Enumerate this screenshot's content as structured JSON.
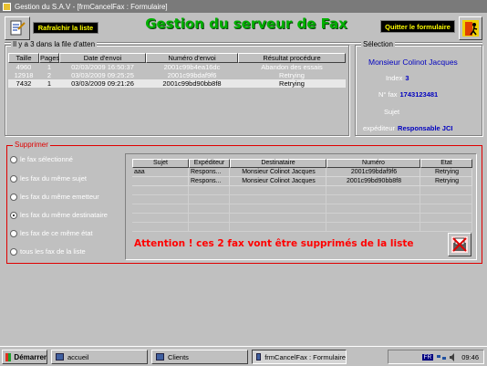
{
  "window": {
    "title": "Gestion du S.A.V - [frmCancelFax : Formulaire]"
  },
  "toolbar": {
    "refresh_label": "Rafraîchir la liste",
    "main_title": "Gestion du serveur de Fax",
    "quit_label": "Quitter le formulaire"
  },
  "fax_list": {
    "group_label": "Il y a 3 dans la file d'atten",
    "columns": [
      "Taille",
      "Pages",
      "Date d'envoi",
      "Numéro d'envoi",
      "Résultat procédure"
    ],
    "rows": [
      {
        "taille": "4960",
        "pages": "1",
        "date": "02/03/2009 16:50:37",
        "numero": "2001c99b4ea16dc",
        "resultat": "Abandon des essais"
      },
      {
        "taille": "12918",
        "pages": "2",
        "date": "03/03/2009 09:25:25",
        "numero": "2001c99bdaf9f6",
        "resultat": "Retrying"
      },
      {
        "taille": "7432",
        "pages": "1",
        "date": "03/03/2009 09:21:26",
        "numero": "2001c99bd90bb8f8",
        "resultat": "Retrying"
      }
    ]
  },
  "selection": {
    "group_label": "Sélection",
    "name": "Monsieur  Colinot  Jacques",
    "index_label": "Index",
    "index_value": "3",
    "fax_label": "N° fax",
    "fax_value": "1743123481",
    "sujet_label": "Sujet",
    "sujet_value": "",
    "expediteur_label": "expéditeur",
    "expediteur_value": "Responsable JCI"
  },
  "supprimer": {
    "group_label": "Supprimer",
    "options": [
      {
        "label": "le fax sélectionné",
        "selected": false
      },
      {
        "label": "les fax du même sujet",
        "selected": false
      },
      {
        "label": "les fax du même emetteur",
        "selected": false
      },
      {
        "label": "les fax du même destinataire",
        "selected": true
      },
      {
        "label": "les fax de ce même état",
        "selected": false
      },
      {
        "label": "tous les fax de la liste",
        "selected": false
      }
    ],
    "columns": [
      "Sujet",
      "Expéditeur",
      "Destinataire",
      "Numéro",
      "Etat"
    ],
    "rows": [
      {
        "sujet": "aaa",
        "expediteur": "Respons...",
        "destinataire": "Monsieur Colinot Jacques",
        "numero": "2001c99bdaf9f6",
        "etat": "Retrying"
      },
      {
        "sujet": "",
        "expediteur": "Respons...",
        "destinataire": "Monsieur Colinot Jacques",
        "numero": "2001c99bd90bb8f8",
        "etat": "Retrying"
      }
    ],
    "warning": "Attention ! ces 2 fax vont être supprimés de la liste"
  },
  "taskbar": {
    "start_label": "Démarrer",
    "tasks": [
      "accueil",
      "Clients",
      "frmCancelFax : Formulaire"
    ],
    "lang": "FR",
    "time": "09:46"
  },
  "colors": {
    "title_green": "#00b000",
    "warning_red": "#ff0000",
    "selection_blue": "#0000c0",
    "button_yellow": "#ffff00"
  }
}
